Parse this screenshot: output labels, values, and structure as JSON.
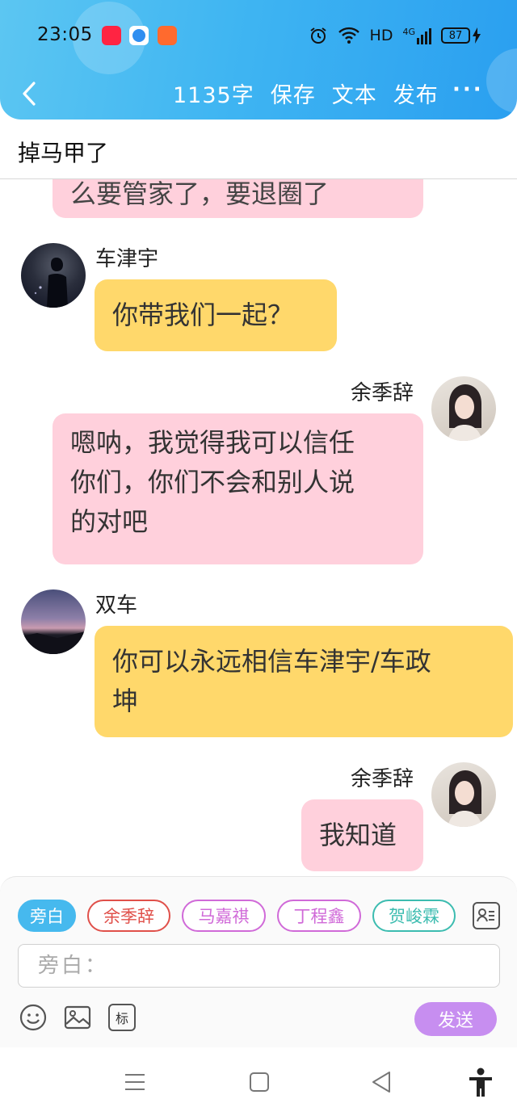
{
  "status_bar": {
    "time": "23:05",
    "network": "HD",
    "network_type": "4G",
    "battery": "87"
  },
  "nav": {
    "word_count": "1135字",
    "save": "保存",
    "text": "文本",
    "publish": "发布",
    "more": "···"
  },
  "title": "掉马甲了",
  "messages": [
    {
      "side": "right",
      "speaker": "",
      "text": "么要管家了，要退圈了",
      "color": "pink"
    },
    {
      "side": "left",
      "speaker": "车津宇",
      "text": "你带我们一起？",
      "color": "yellow"
    },
    {
      "side": "right",
      "speaker": "余季辞",
      "text_lines": [
        "嗯呐，我觉得我可以信任",
        "你们，你们不会和别人说",
        "的对吧"
      ],
      "color": "pink"
    },
    {
      "side": "left",
      "speaker": "双车",
      "text_lines": [
        "你可以永远相信车津宇/车政",
        "坤"
      ],
      "color": "yellow"
    },
    {
      "side": "right",
      "speaker": "余季辞",
      "text": "我知道",
      "color": "pink"
    }
  ],
  "roles": [
    {
      "label": "旁白",
      "color": "#46b9ee",
      "active": true
    },
    {
      "label": "余季辞",
      "color": "#e0504a",
      "active": false
    },
    {
      "label": "马嘉祺",
      "color": "#d06ad8",
      "active": false
    },
    {
      "label": "丁程鑫",
      "color": "#d06ad8",
      "active": false
    },
    {
      "label": "贺峻霖",
      "color": "#3cbcb0",
      "active": false
    }
  ],
  "input": {
    "placeholder": "旁白：",
    "value": ""
  },
  "tools": {
    "tag": "标",
    "send": "发送"
  },
  "colors": {
    "header": "#3fb5f2",
    "pink_bubble": "#ffd0dc",
    "yellow_bubble": "#ffd86b",
    "send": "#c78ef0"
  }
}
